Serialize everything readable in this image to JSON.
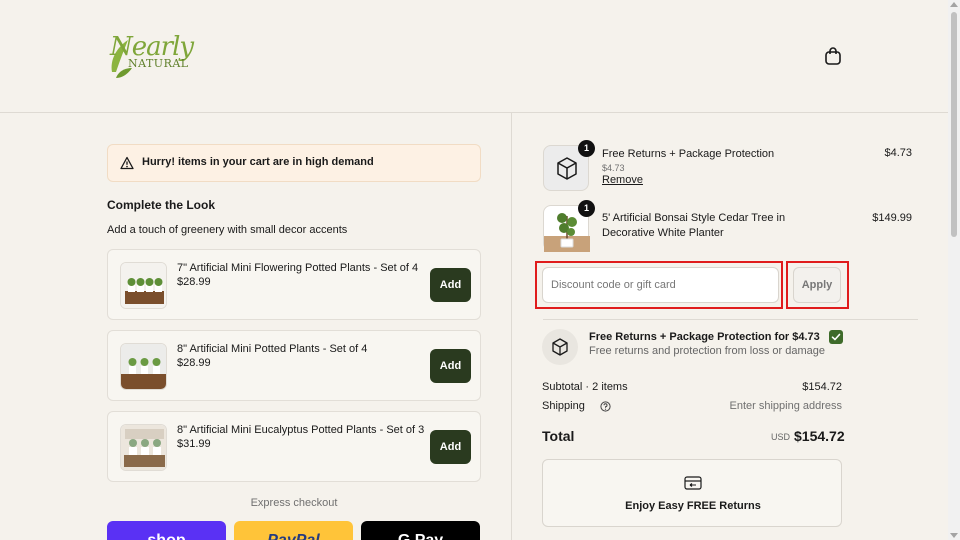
{
  "header": {
    "logo_main": "Nearly",
    "logo_sub": "NATURAL",
    "cart_icon": "shopping-bag-icon"
  },
  "alert": {
    "icon": "warning-icon",
    "text": "Hurry! items in your cart are in high demand"
  },
  "upsell": {
    "title": "Complete the Look",
    "subtitle": "Add a touch of greenery with small decor accents",
    "add_label": "Add",
    "products": [
      {
        "name": "7\" Artificial Mini Flowering Potted Plants - Set of 4",
        "price": "$28.99"
      },
      {
        "name": "8\" Artificial Mini Potted Plants - Set of 4",
        "price": "$28.99"
      },
      {
        "name": "8\" Artificial Mini Eucalyptus Potted Plants - Set of 3",
        "price": "$31.99"
      }
    ]
  },
  "express": {
    "label": "Express checkout",
    "shop": "shop",
    "paypal": "PayPal",
    "gpay": "G Pay"
  },
  "cart": {
    "items": [
      {
        "qty": "1",
        "name": "Free Returns + Package Protection",
        "price": "$4.73",
        "sub_price": "$4.73",
        "remove": "Remove"
      },
      {
        "qty": "1",
        "name": "5' Artificial Bonsai Style Cedar Tree in Decorative White Planter",
        "price": "$149.99"
      }
    ]
  },
  "discount": {
    "placeholder": "Discount code or gift card",
    "apply_label": "Apply"
  },
  "protection": {
    "title": "Free Returns + Package Protection for $4.73",
    "subtitle": "Free returns and protection from loss or damage",
    "checked": true
  },
  "summary": {
    "subtotal_label": "Subtotal · 2 items",
    "subtotal_value": "$154.72",
    "shipping_label": "Shipping",
    "shipping_value": "Enter shipping address",
    "total_label": "Total",
    "currency": "USD",
    "total_value": "$154.72"
  },
  "returns_card": {
    "text": "Enjoy Easy FREE Returns"
  }
}
